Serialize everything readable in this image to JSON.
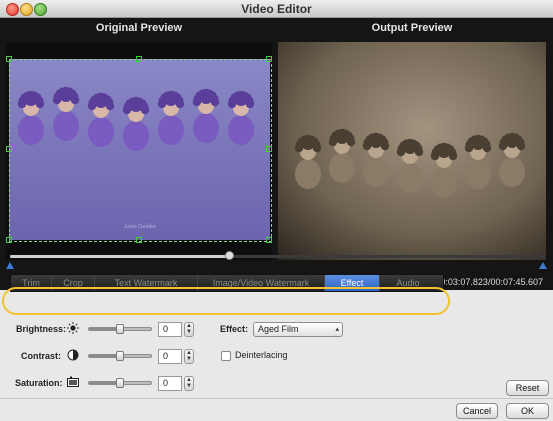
{
  "window": {
    "title": "Video Editor"
  },
  "preview": {
    "original_title": "Original Preview",
    "output_title": "Output Preview",
    "watermark_text": "Anne Geddes"
  },
  "playback": {
    "timecode": "00:03:07.823/00:07:45.607",
    "progress": 0.41,
    "controls": [
      "play-icon",
      "stop-icon",
      "snapshot-icon",
      "mark-in-icon",
      "mark-out-icon",
      "flip-horizontal-icon",
      "flip-left-icon"
    ]
  },
  "tabs": [
    {
      "label": "Trim"
    },
    {
      "label": "Crop"
    },
    {
      "label": "Text Watermark"
    },
    {
      "label": "Image/Video Watermark"
    },
    {
      "label": "Effect"
    },
    {
      "label": "Audio"
    }
  ],
  "active_tab": "Effect",
  "effect": {
    "brightness_label": "Brightness:",
    "brightness_value": "0",
    "brightness_level": 0.5,
    "contrast_label": "Contrast:",
    "contrast_value": "0",
    "contrast_level": 0.5,
    "saturation_label": "Saturation:",
    "saturation_value": "0",
    "saturation_level": 0.5,
    "effect_label": "Effect:",
    "effect_value": "Aged Film",
    "deinterlacing_label": "Deinterlacing",
    "deinterlacing_checked": false
  },
  "buttons": {
    "reset": "Reset",
    "cancel": "Cancel",
    "ok": "OK"
  },
  "colors": {
    "accent": "#2f63c2",
    "highlight": "#f2c230",
    "preview_bg": "#151515"
  }
}
